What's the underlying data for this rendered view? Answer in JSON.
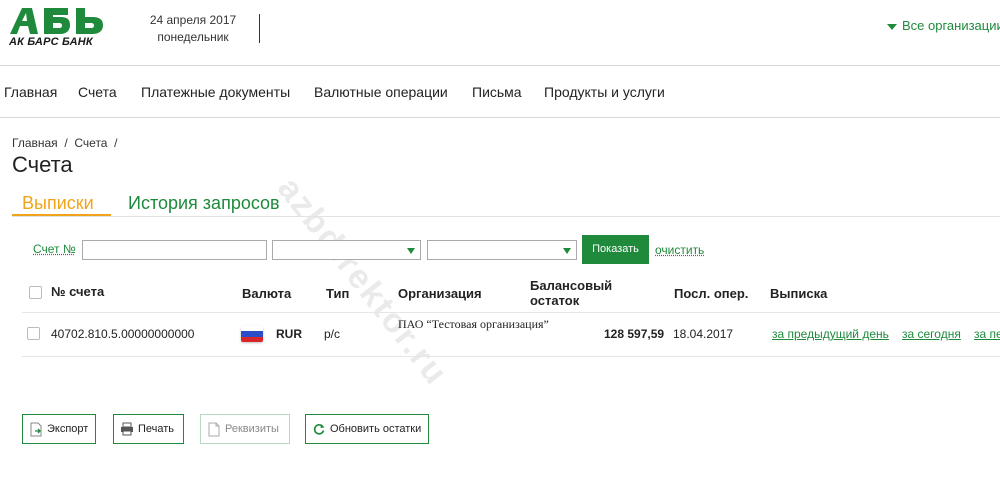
{
  "header": {
    "logo_text": "АК БАРС БАНК",
    "date_line1": "24 апреля 2017",
    "date_line2": "понедельник",
    "org_select": "Все организации",
    "brand_color": "#1f8a3c"
  },
  "nav": {
    "items": [
      "Главная",
      "Счета",
      "Платежные документы",
      "Валютные операции",
      "Письма",
      "Продукты и услуги"
    ]
  },
  "watermark": "azbdirektor.ru",
  "breadcrumb": [
    "Главная",
    "Счета"
  ],
  "page_title": "Счета",
  "tabs": [
    {
      "label": "Выписки",
      "active": true,
      "color": "#f0a41c"
    },
    {
      "label": "История запросов",
      "active": false
    }
  ],
  "filter": {
    "account_label": "Счет №",
    "account_value": "",
    "select1_value": "",
    "select2_value": "",
    "show_button": "Показать",
    "clear_link": "очистить"
  },
  "table": {
    "headers": {
      "account": "№ счета",
      "currency": "Валюта",
      "type": "Тип",
      "organization": "Организация",
      "balance": "Балансовый остаток",
      "last_op": "Посл. опер.",
      "statement": "Выписка"
    },
    "rows": [
      {
        "account": "40702.810.5.00000000000",
        "flag": "russia-flag-icon",
        "currency": "RUR",
        "type": "р/с",
        "organization": "ПАО “Тестовая организация”",
        "balance": "128 597,59",
        "last_op": "18.04.2017",
        "statement_links": [
          "за предыдущий день",
          "за сегодня",
          "за пе"
        ]
      }
    ]
  },
  "actions": {
    "export": "Экспорт",
    "print": "Печать",
    "requisites": "Реквизиты",
    "refresh": "Обновить остатки"
  }
}
